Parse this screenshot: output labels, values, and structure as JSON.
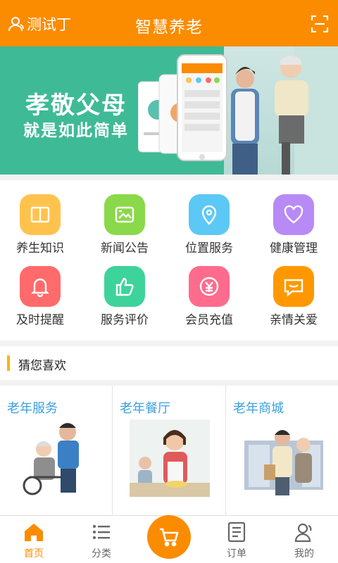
{
  "header": {
    "user_name": "测试丁",
    "title": "智慧养老"
  },
  "banner": {
    "slogan_line1": "孝敬父母",
    "slogan_line2": "就是如此简单"
  },
  "features": [
    {
      "label": "养生知识",
      "icon": "book-icon",
      "color": "#ffc34d"
    },
    {
      "label": "新闻公告",
      "icon": "image-icon",
      "color": "#8ad94a"
    },
    {
      "label": "位置服务",
      "icon": "location-pin-icon",
      "color": "#5cc8f5"
    },
    {
      "label": "健康管理",
      "icon": "heart-icon",
      "color": "#b88af5"
    },
    {
      "label": "及时提醒",
      "icon": "bell-icon",
      "color": "#ff6b6b"
    },
    {
      "label": "服务评价",
      "icon": "thumbs-up-icon",
      "color": "#3ed39b"
    },
    {
      "label": "会员充值",
      "icon": "yen-icon",
      "color": "#ff6b8d"
    },
    {
      "label": "亲情关爱",
      "icon": "chat-icon",
      "color": "#ff9800"
    }
  ],
  "section": {
    "title": "猜您喜欢"
  },
  "cards": [
    {
      "title": "老年服务"
    },
    {
      "title": "老年餐厅"
    },
    {
      "title": "老年商城"
    }
  ],
  "tabbar": {
    "home": "首页",
    "category": "分类",
    "orders": "订单",
    "mine": "我的"
  },
  "colors": {
    "brand": "#fb8c00",
    "banner_green": "#3fba97",
    "card_title": "#3aa0e0"
  }
}
